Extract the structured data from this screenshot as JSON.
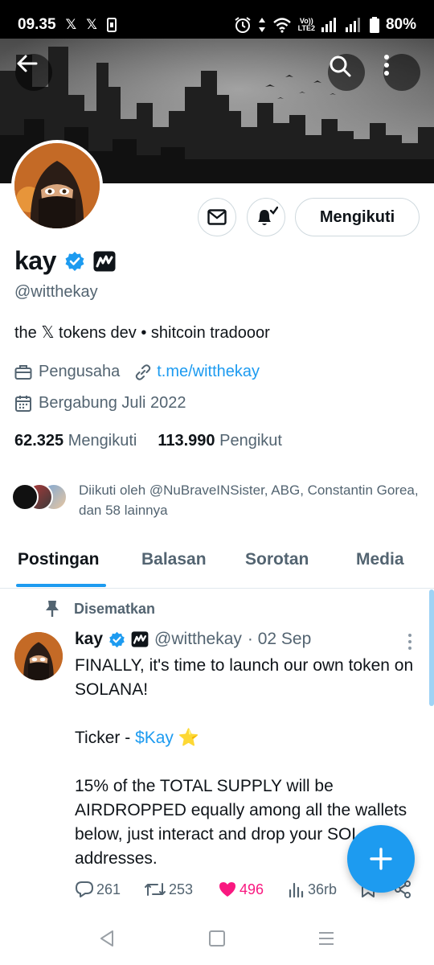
{
  "status_bar": {
    "time": "09.35",
    "notif_icons": [
      "x-logo-icon",
      "x-logo-icon",
      "sim-icon"
    ],
    "volte_top": "Vo))",
    "volte_bottom": "LTE2",
    "battery": "80%"
  },
  "profile": {
    "name": "kay",
    "handle": "@witthekay",
    "bio": "the 𝕏 tokens dev • shitcoin tradooor",
    "category": "Pengusaha",
    "link": "t.me/witthekay",
    "joined": "Bergabung Juli 2022",
    "following_count": "62.325",
    "following_label": "Mengikuti",
    "followers_count": "113.990",
    "followers_label": "Pengikut",
    "followed_by": "Diikuti oleh @NuBraveINSister, ABG, Constantin Gorea, dan 58 lainnya",
    "follow_button": "Mengikuti"
  },
  "tabs": [
    {
      "label": "Postingan",
      "active": true
    },
    {
      "label": "Balasan",
      "active": false
    },
    {
      "label": "Sorotan",
      "active": false
    },
    {
      "label": "Media",
      "active": false
    }
  ],
  "tweet": {
    "pinned_label": "Disematkan",
    "author_name": "kay",
    "author_handle": "@witthekay",
    "date": "· 02 Sep",
    "line1": "FINALLY, it's time to launch our own token on SOLANA!",
    "ticker_prefix": "Ticker - ",
    "cashtag": "$Kay",
    "ticker_emoji": "⭐",
    "line3": "15% of the TOTAL SUPPLY will be AIRDROPPED equally among all the wallets below, just interact and drop your SOL addresses.",
    "replies": "261",
    "retweets": "253",
    "likes": "496",
    "views": "36rb"
  },
  "colors": {
    "accent": "#1d9bf0",
    "like": "#f91880",
    "secondary_text": "#536471",
    "primary_text": "#0f1419"
  }
}
